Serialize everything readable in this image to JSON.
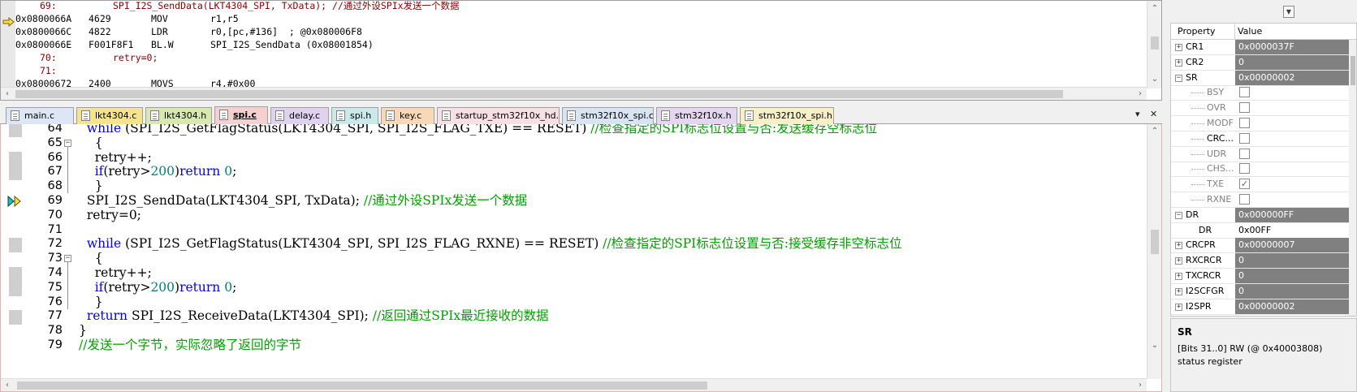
{
  "disassembly": {
    "lines": [
      {
        "kind": "src",
        "lineno": "69:",
        "code": "SPI_I2S_SendData(LKT4304_SPI, TxData); //通过外设SPIx发送一个数据"
      },
      {
        "kind": "asm",
        "addr": "0x0800066A",
        "opcode": "4629",
        "mnemonic": "MOV",
        "operands": "r1,r5"
      },
      {
        "kind": "asm",
        "addr": "0x0800066C",
        "opcode": "4822",
        "mnemonic": "LDR",
        "operands": "r0,[pc,#136]  ; @0x080006F8"
      },
      {
        "kind": "asm",
        "addr": "0x0800066E",
        "opcode": "F001F8F1",
        "mnemonic": "BL.W",
        "operands": "SPI_I2S_SendData (0x08001854)"
      },
      {
        "kind": "src",
        "lineno": "70:",
        "code": "retry=0;"
      },
      {
        "kind": "src",
        "lineno": "71:",
        "code": ""
      },
      {
        "kind": "asm",
        "addr": "0x08000672",
        "opcode": "2400",
        "mnemonic": "MOVS",
        "operands": "r4,#0x00"
      }
    ]
  },
  "tabs": [
    {
      "label": "main.c",
      "color": "#dde6f4"
    },
    {
      "label": "lkt4304.c",
      "color": "#f5e48a"
    },
    {
      "label": "lkt4304.h",
      "color": "#d9e8b0"
    },
    {
      "label": "spi.c",
      "color": "#f6cfd0",
      "active": true
    },
    {
      "label": "delay.c",
      "color": "#e0d2ee"
    },
    {
      "label": "spi.h",
      "color": "#c9e9ea"
    },
    {
      "label": "key.c",
      "color": "#f9d8b8"
    },
    {
      "label": "startup_stm32f10x_hd.s",
      "color": "#f7dfe6"
    },
    {
      "label": "stm32f10x_spi.c",
      "color": "#d8e4f2"
    },
    {
      "label": "stm32f10x.h",
      "color": "#e3d6ee"
    },
    {
      "label": "stm32f10x_spi.h",
      "color": "#f6efc8"
    }
  ],
  "tab_controls": {
    "dropdown": "▾",
    "close": "✕"
  },
  "editor": {
    "lines": [
      {
        "n": "64",
        "parts": [
          [
            "kw",
            "  while "
          ],
          [
            "t",
            "(SPI_I2S_GetFlagStatus(LKT4304_SPI, SPI_I2S_FLAG_TXE) == RESET) "
          ],
          [
            "cmt",
            "//检查指定的SPI标志位设置与否:发送缓存空标志位"
          ]
        ]
      },
      {
        "n": "65",
        "parts": [
          [
            "t",
            "    {"
          ]
        ]
      },
      {
        "n": "66",
        "parts": [
          [
            "t",
            "    retry++;"
          ]
        ]
      },
      {
        "n": "67",
        "parts": [
          [
            "t",
            "    "
          ],
          [
            "kw",
            "if"
          ],
          [
            "t",
            "(retry>"
          ],
          [
            "num",
            "200"
          ],
          [
            "t",
            ")"
          ],
          [
            "kw",
            "return "
          ],
          [
            "num",
            "0"
          ],
          [
            "t",
            ";"
          ]
        ]
      },
      {
        "n": "68",
        "parts": [
          [
            "t",
            "    }"
          ]
        ]
      },
      {
        "n": "69",
        "parts": [
          [
            "t",
            "  SPI_I2S_SendData(LKT4304_SPI, TxData); "
          ],
          [
            "cmt",
            "//通过外设SPIx发送一个数据"
          ]
        ]
      },
      {
        "n": "70",
        "parts": [
          [
            "t",
            "  retry=0;"
          ]
        ]
      },
      {
        "n": "71",
        "parts": [
          [
            "t",
            ""
          ]
        ]
      },
      {
        "n": "72",
        "parts": [
          [
            "kw",
            "  while "
          ],
          [
            "t",
            "(SPI_I2S_GetFlagStatus(LKT4304_SPI, SPI_I2S_FLAG_RXNE) == RESET) "
          ],
          [
            "cmt",
            "//检查指定的SPI标志位设置与否:接受缓存非空标志位"
          ]
        ]
      },
      {
        "n": "73",
        "parts": [
          [
            "t",
            "    {"
          ]
        ]
      },
      {
        "n": "74",
        "parts": [
          [
            "t",
            "    retry++;"
          ]
        ]
      },
      {
        "n": "75",
        "parts": [
          [
            "t",
            "    "
          ],
          [
            "kw",
            "if"
          ],
          [
            "t",
            "(retry>"
          ],
          [
            "num",
            "200"
          ],
          [
            "t",
            ")"
          ],
          [
            "kw",
            "return "
          ],
          [
            "num",
            "0"
          ],
          [
            "t",
            ";"
          ]
        ]
      },
      {
        "n": "76",
        "parts": [
          [
            "t",
            "    }"
          ]
        ]
      },
      {
        "n": "77",
        "parts": [
          [
            "kw",
            "  return "
          ],
          [
            "t",
            "SPI_I2S_ReceiveData(LKT4304_SPI); "
          ],
          [
            "cmt",
            "//返回通过SPIx最近接收的数据"
          ]
        ]
      },
      {
        "n": "78",
        "parts": [
          [
            "t",
            "}"
          ]
        ]
      },
      {
        "n": "79",
        "parts": [
          [
            "cmt",
            "//发送一个字节，实际忽略了返回的字节"
          ]
        ]
      }
    ]
  },
  "properties": {
    "header_property": "Property",
    "header_value": "Value",
    "rows": [
      {
        "name": "CR1",
        "value": "0x0000037F",
        "type": "reg",
        "expander": "+"
      },
      {
        "name": "CR2",
        "value": "0",
        "type": "reg",
        "expander": "+"
      },
      {
        "name": "SR",
        "value": "0x00000002",
        "type": "reg",
        "expander": "-"
      },
      {
        "name": "BSY",
        "type": "bit",
        "checked": false
      },
      {
        "name": "OVR",
        "type": "bit",
        "checked": false
      },
      {
        "name": "MODF",
        "type": "bit",
        "checked": false
      },
      {
        "name": "CRC...",
        "type": "bit",
        "checked": false,
        "dark": true
      },
      {
        "name": "UDR",
        "type": "bit",
        "checked": false
      },
      {
        "name": "CHS...",
        "type": "bit",
        "checked": false
      },
      {
        "name": "TXE",
        "type": "bit",
        "checked": true
      },
      {
        "name": "RXNE",
        "type": "bit",
        "checked": false
      },
      {
        "name": "DR",
        "value": "0x000000FF",
        "type": "reg",
        "expander": "-"
      },
      {
        "name": "DR",
        "value": "0x00FF",
        "type": "field"
      },
      {
        "name": "CRCPR",
        "value": "0x00000007",
        "type": "reg",
        "expander": "+"
      },
      {
        "name": "RXCRCR",
        "value": "0",
        "type": "reg",
        "expander": "+"
      },
      {
        "name": "TXCRCR",
        "value": "0",
        "type": "reg",
        "expander": "+"
      },
      {
        "name": "I2SCFGR",
        "value": "0",
        "type": "reg",
        "expander": "+"
      },
      {
        "name": "I2SPR",
        "value": "0x00000002",
        "type": "reg",
        "expander": "+"
      }
    ],
    "description": {
      "title": "SR",
      "text": "[Bits 31..0] RW (@ 0x40003808) status register"
    }
  }
}
